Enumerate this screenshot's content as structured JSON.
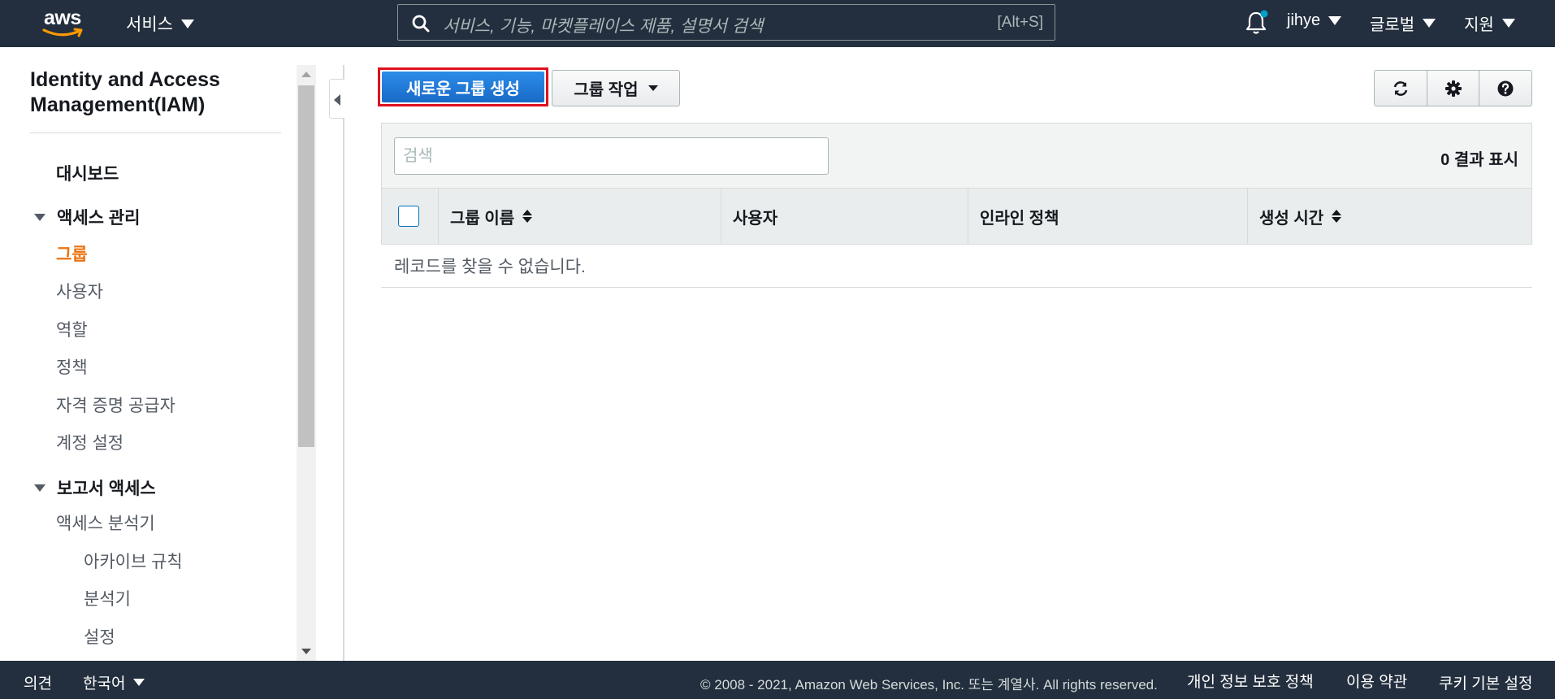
{
  "topnav": {
    "logo_text": "aws",
    "services_label": "서비스",
    "search_placeholder": "서비스, 기능, 마켓플레이스 제품, 설명서 검색",
    "search_shortcut": "[Alt+S]",
    "user_label": "jihye",
    "region_label": "글로벌",
    "support_label": "지원"
  },
  "sidebar": {
    "title": "Identity and Access Management(IAM)",
    "dashboard": "대시보드",
    "access_section": "액세스 관리",
    "access_items": [
      "그룹",
      "사용자",
      "역할",
      "정책",
      "자격 증명 공급자",
      "계정 설정"
    ],
    "reports_section": "보고서 액세스",
    "reports_items": [
      "액세스 분석기"
    ],
    "analyzer_items": [
      "아카이브 규칙",
      "분석기",
      "설정"
    ]
  },
  "toolbar": {
    "create_group_label": "새로운 그룹 생성",
    "group_actions_label": "그룹 작업",
    "icons": [
      "refresh-icon",
      "gear-icon",
      "help-icon"
    ]
  },
  "table": {
    "filter_placeholder": "검색",
    "result_count": "0 결과 표시",
    "columns": [
      "그룹 이름",
      "사용자",
      "인라인 정책",
      "생성 시간"
    ],
    "empty_message": "레코드를 찾을 수 없습니다."
  },
  "footer": {
    "feedback": "의견",
    "language": "한국어",
    "copyright": "© 2008 - 2021, Amazon Web Services, Inc. 또는 계열사. All rights reserved.",
    "privacy": "개인 정보 보호 정책",
    "terms": "이용 약관",
    "cookies": "쿠키 기본 설정"
  },
  "colors": {
    "nav_bg": "#232f3e",
    "primary_button": "#1a6ac7",
    "active_nav": "#ec7211",
    "highlight_border": "#e0111f",
    "notification_dot": "#00a1c9"
  }
}
